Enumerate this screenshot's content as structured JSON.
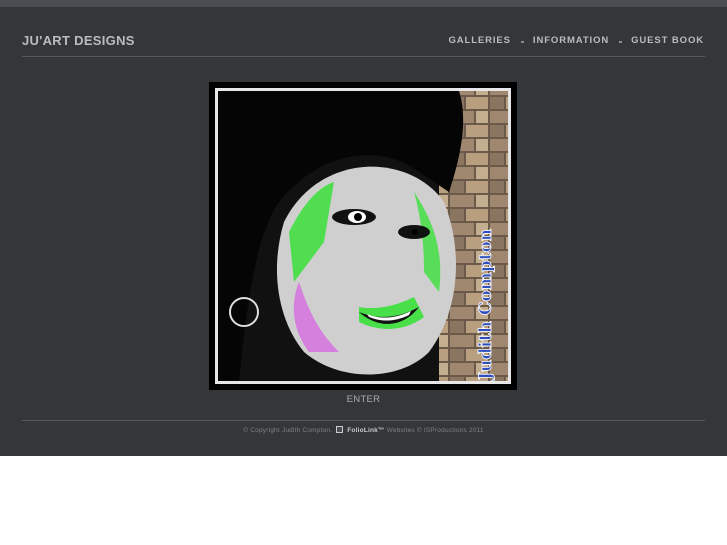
{
  "site": {
    "logo": "JU'ART DESIGNS"
  },
  "nav": {
    "items": [
      {
        "label": "GALLERIES"
      },
      {
        "label": "INFORMATION"
      },
      {
        "label": "GUEST BOOK"
      }
    ]
  },
  "photo": {
    "signature_text": "Judith Compton"
  },
  "enter_label": "ENTER",
  "footer": {
    "copyright": "© Copyright Judith Compton.",
    "brand": "FolioLink™",
    "rest": "Websites © ISProductions 2011"
  },
  "colors": {
    "page_bg": "#34373a",
    "lower_bg": "#ffffff",
    "text_light": "#b9bcbf",
    "accent_green": "#39e03a",
    "accent_magenta": "#d76be0"
  }
}
